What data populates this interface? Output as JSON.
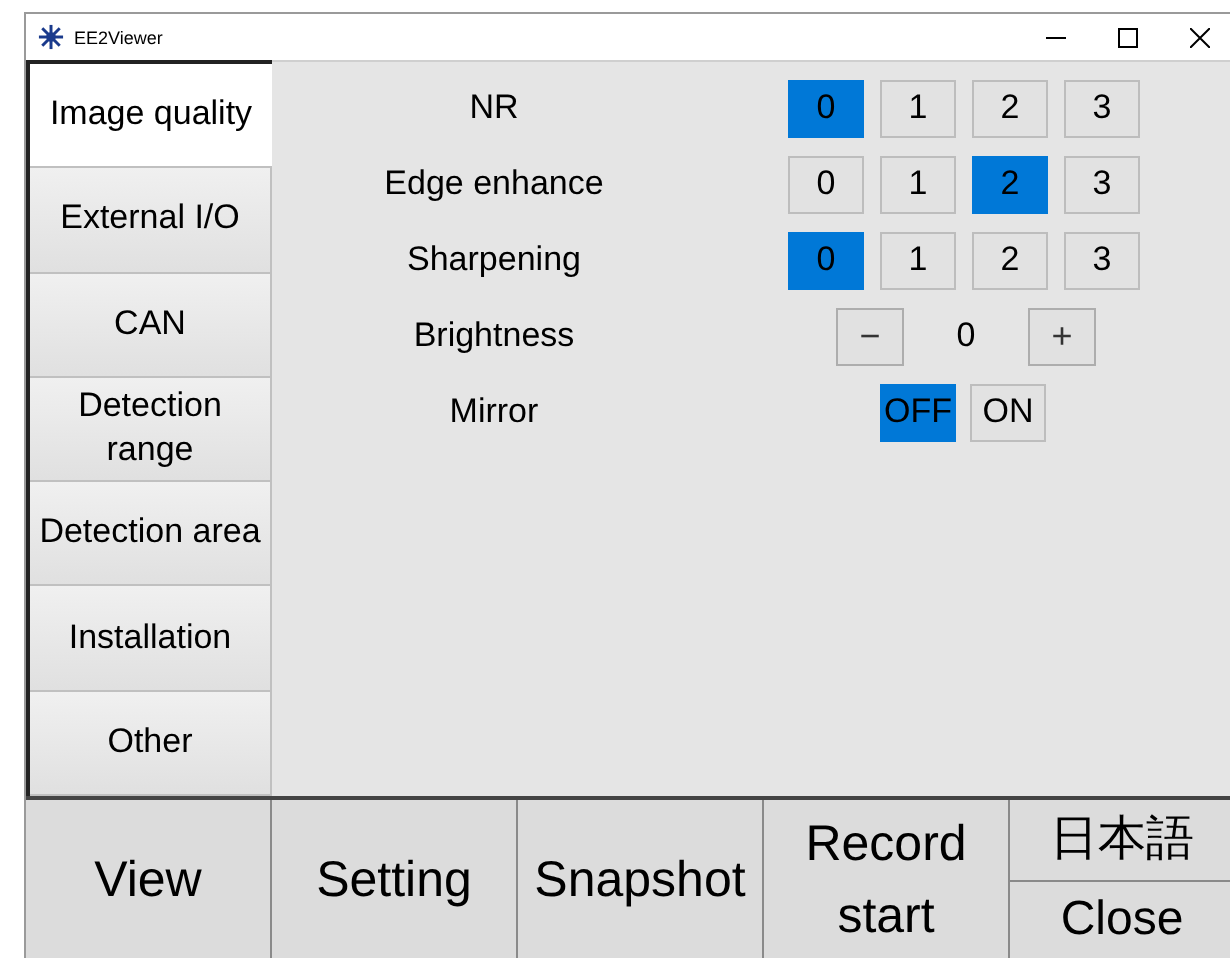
{
  "window": {
    "title": "EE2Viewer"
  },
  "tabs": [
    {
      "label": "Image quality",
      "selected": true
    },
    {
      "label": "External I/O",
      "selected": false
    },
    {
      "label": "CAN",
      "selected": false
    },
    {
      "label": "Detection range",
      "selected": false
    },
    {
      "label": "Detection area",
      "selected": false
    },
    {
      "label": "Installation",
      "selected": false
    },
    {
      "label": "Other",
      "selected": false
    }
  ],
  "settings": [
    {
      "kind": "segmented",
      "label": "NR",
      "options": [
        {
          "label": "0",
          "selected": true
        },
        {
          "label": "1",
          "selected": false
        },
        {
          "label": "2",
          "selected": false
        },
        {
          "label": "3",
          "selected": false
        }
      ]
    },
    {
      "kind": "segmented",
      "label": "Edge enhance",
      "options": [
        {
          "label": "0",
          "selected": false
        },
        {
          "label": "1",
          "selected": false
        },
        {
          "label": "2",
          "selected": true
        },
        {
          "label": "3",
          "selected": false
        }
      ]
    },
    {
      "kind": "segmented",
      "label": "Sharpening",
      "options": [
        {
          "label": "0",
          "selected": true
        },
        {
          "label": "1",
          "selected": false
        },
        {
          "label": "2",
          "selected": false
        },
        {
          "label": "3",
          "selected": false
        }
      ]
    },
    {
      "kind": "stepper",
      "label": "Brightness",
      "minus": "−",
      "value": "0",
      "plus": "+"
    },
    {
      "kind": "toggle",
      "label": "Mirror",
      "options": [
        {
          "label": "OFF",
          "selected": true
        },
        {
          "label": "ON",
          "selected": false
        }
      ]
    }
  ],
  "bottom_buttons": [
    "View",
    "Setting",
    "Snapshot",
    "Record start"
  ],
  "language_button": "日本語",
  "close_button": "Close"
}
